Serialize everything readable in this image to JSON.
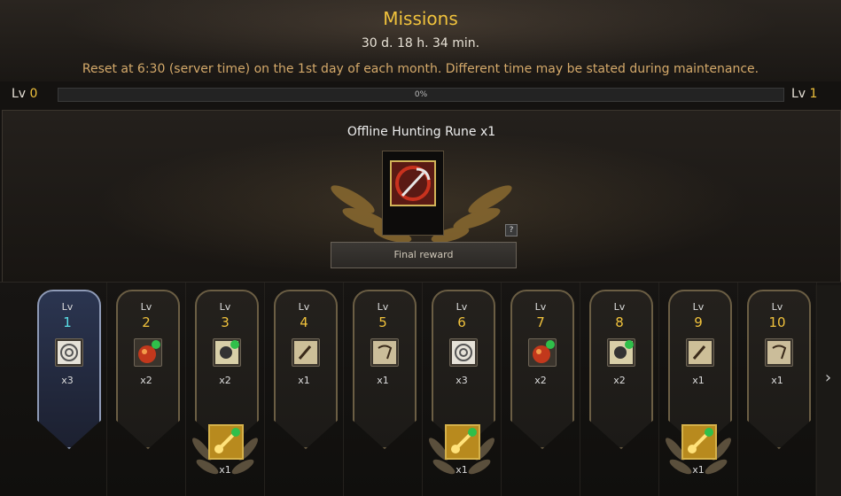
{
  "header": {
    "title": "Missions",
    "timer": "30 d. 18 h. 34 min.",
    "reset_note": "Reset at 6:30 (server time) on the 1st day of each month. Different time may be stated during maintenance."
  },
  "level_bar": {
    "current_label": "Lv",
    "current_value": "0",
    "next_label": "Lv",
    "next_value": "1",
    "progress_text": "0%",
    "progress": 0
  },
  "final_reward": {
    "title": "Offline Hunting Rune x1",
    "icon": "pickaxe-rune-icon",
    "help_label": "?",
    "button_label": "Final reward"
  },
  "rewards": [
    {
      "lv_label": "Lv",
      "level": "1",
      "icon": "scroll-icon",
      "qty": "x3",
      "active": true
    },
    {
      "lv_label": "Lv",
      "level": "2",
      "icon": "red-potion-icon",
      "qty": "x2",
      "active": false
    },
    {
      "lv_label": "Lv",
      "level": "3",
      "icon": "skull-scroll-icon",
      "qty": "x2",
      "active": false,
      "bonus": {
        "icon": "gold-note-icon",
        "qty": "x1"
      }
    },
    {
      "lv_label": "Lv",
      "level": "4",
      "icon": "map-scroll-icon",
      "qty": "x1",
      "active": false
    },
    {
      "lv_label": "Lv",
      "level": "5",
      "icon": "parchment-icon",
      "qty": "x1",
      "active": false
    },
    {
      "lv_label": "Lv",
      "level": "6",
      "icon": "scroll-icon",
      "qty": "x3",
      "active": false,
      "bonus": {
        "icon": "gold-note-icon",
        "qty": "x1"
      }
    },
    {
      "lv_label": "Lv",
      "level": "7",
      "icon": "red-potion-icon",
      "qty": "x2",
      "active": false
    },
    {
      "lv_label": "Lv",
      "level": "8",
      "icon": "skull-scroll-icon",
      "qty": "x2",
      "active": false
    },
    {
      "lv_label": "Lv",
      "level": "9",
      "icon": "map-scroll-icon",
      "qty": "x1",
      "active": false,
      "bonus": {
        "icon": "gold-note-icon",
        "qty": "x1"
      }
    },
    {
      "lv_label": "Lv",
      "level": "10",
      "icon": "parchment-icon",
      "qty": "x1",
      "active": false
    }
  ],
  "nav": {
    "next_arrow": "›"
  },
  "colors": {
    "gold": "#f0c23c",
    "cyan_active": "#5be0e8",
    "note": "#d4a96a"
  }
}
